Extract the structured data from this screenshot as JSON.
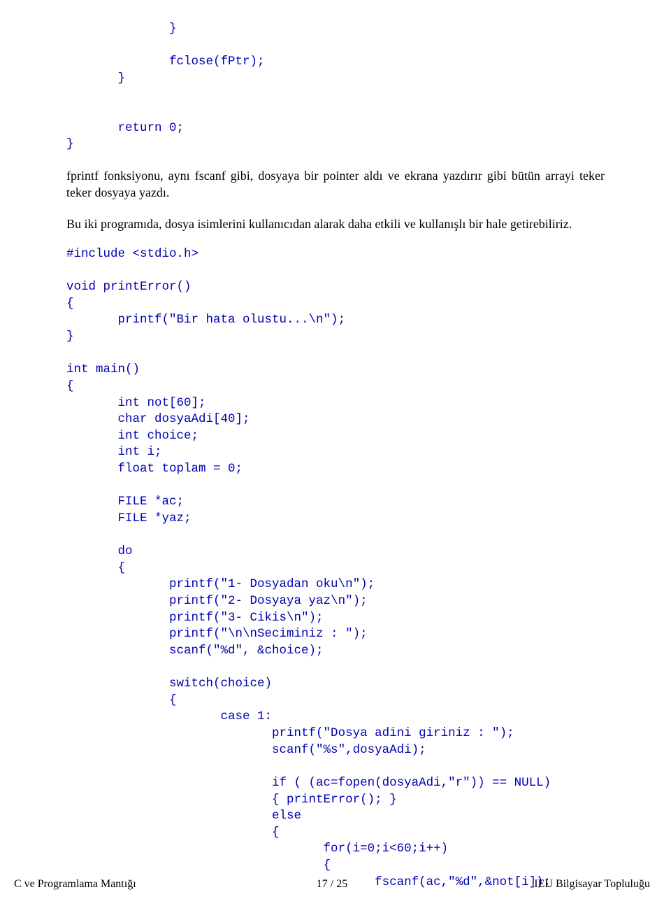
{
  "code": {
    "top": "              }\n\n              fclose(fPtr);\n       }\n\n\n       return 0;\n}",
    "mid": "#include <stdio.h>\n\nvoid printError()\n{\n       printf(\"Bir hata olustu...\\n\");\n}\n\nint main()\n{\n       int not[60];\n       char dosyaAdi[40];\n       int choice;\n       int i;\n       float toplam = 0;\n\n       FILE *ac;\n       FILE *yaz;\n\n       do\n       {\n              printf(\"1- Dosyadan oku\\n\");\n              printf(\"2- Dosyaya yaz\\n\");\n              printf(\"3- Cikis\\n\");\n              printf(\"\\n\\nSeciminiz : \");\n              scanf(\"%d\", &choice);\n\n              switch(choice)\n              {\n                     case 1:\n                            printf(\"Dosya adini giriniz : \");\n                            scanf(\"%s\",dosyaAdi);\n\n                            if ( (ac=fopen(dosyaAdi,\"r\")) == NULL)\n                            { printError(); }\n                            else\n                            {\n                                   for(i=0;i<60;i++)\n                                   {\n                                          fscanf(ac,\"%d\",&not[i]);"
  },
  "prose": {
    "p1": "fprintf fonksiyonu, aynı fscanf gibi, dosyaya bir pointer aldı ve ekrana yazdırır gibi bütün arrayi teker teker dosyaya yazdı.",
    "p2": "Bu iki programıda, dosya isimlerini kullanıcıdan alarak daha etkili ve kullanışlı bir hale getirebiliriz."
  },
  "footer": {
    "left": "C ve Programlama Mantığı",
    "center": "17 / 25",
    "right": "IEU Bilgisayar Topluluğu"
  }
}
